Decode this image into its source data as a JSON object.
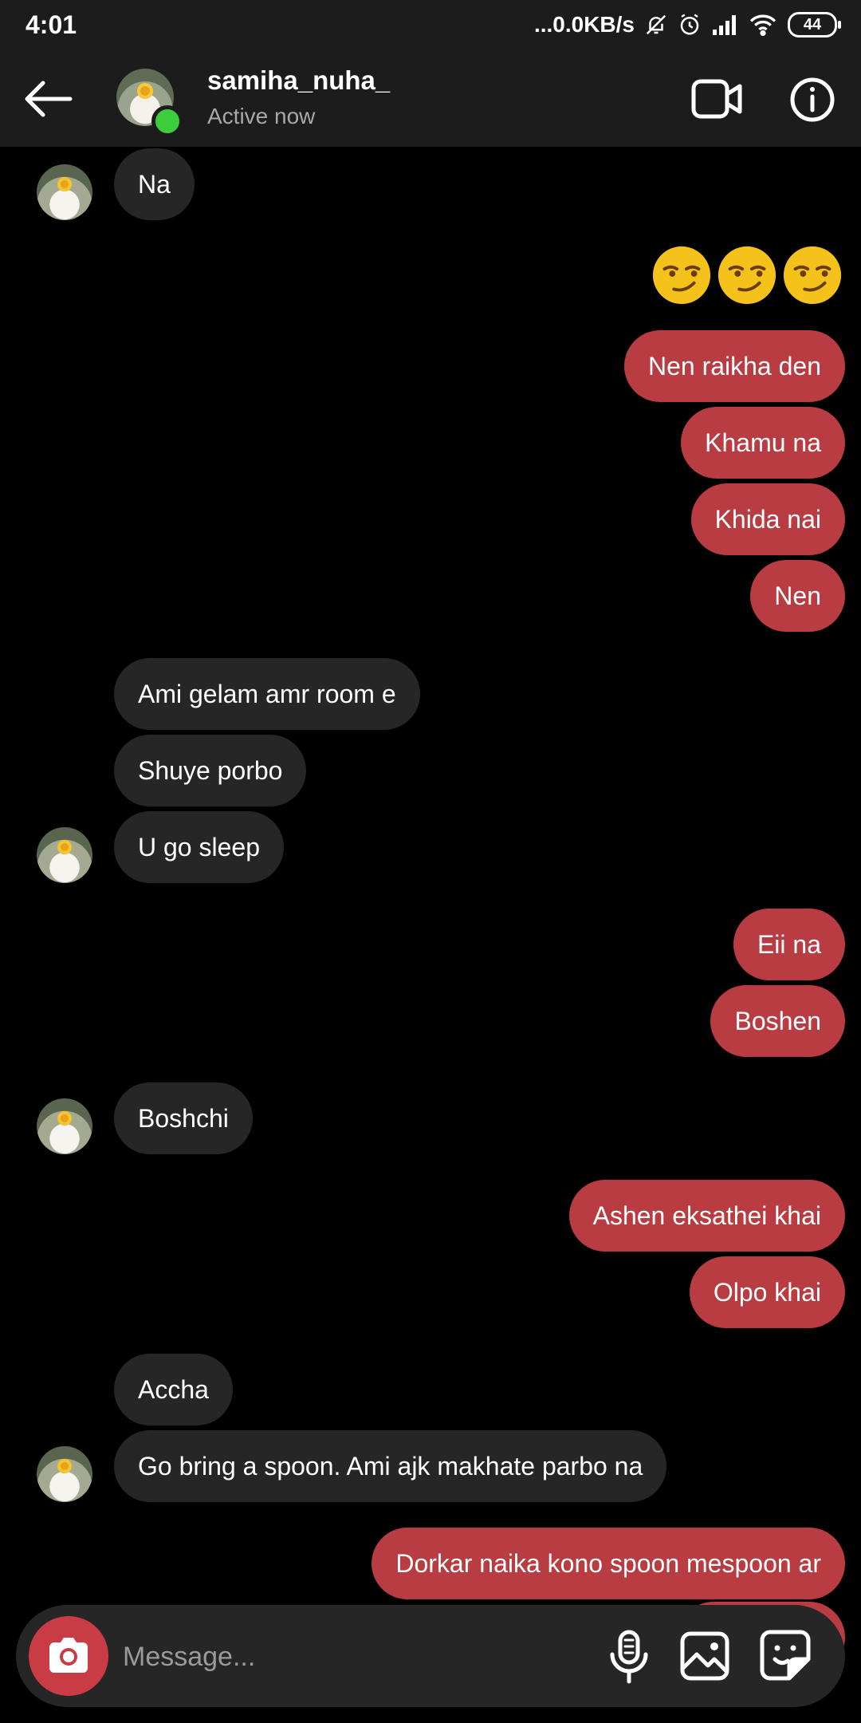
{
  "status_bar": {
    "time": "4:01",
    "network_speed": "...0.0KB/s",
    "battery": "44"
  },
  "header": {
    "username": "samiha_nuha_",
    "status": "Active now",
    "back_icon": "arrow-left-icon",
    "video_icon": "video-call-icon",
    "info_icon": "info-icon"
  },
  "messages": [
    {
      "dir": "in",
      "text": "Na"
    },
    {
      "dir": "out",
      "text": "😏😏😏"
    },
    {
      "dir": "out",
      "text": "Nen raikha den"
    },
    {
      "dir": "out",
      "text": "Khamu na"
    },
    {
      "dir": "out",
      "text": "Khida nai"
    },
    {
      "dir": "out",
      "text": "Nen"
    },
    {
      "dir": "in",
      "text": "Ami gelam amr room e"
    },
    {
      "dir": "in",
      "text": "Shuye porbo"
    },
    {
      "dir": "in",
      "text": "U go sleep"
    },
    {
      "dir": "out",
      "text": "Eii na"
    },
    {
      "dir": "out",
      "text": "Boshen"
    },
    {
      "dir": "in",
      "text": "Boshchi"
    },
    {
      "dir": "out",
      "text": "Ashen eksathei khai"
    },
    {
      "dir": "out",
      "text": "Olpo khai"
    },
    {
      "dir": "in",
      "text": "Accha"
    },
    {
      "dir": "in",
      "text": "Go bring a spoon. Ami ajk makhate parbo na"
    },
    {
      "dir": "out",
      "text": "Dorkar naika kono spoon mespoon ar"
    }
  ],
  "composer": {
    "placeholder": "Message...",
    "camera_icon": "camera-icon",
    "mic_icon": "microphone-icon",
    "gallery_icon": "gallery-icon",
    "sticker_icon": "sticker-icon"
  },
  "colors": {
    "outgoing_bubble": "#b83c42",
    "incoming_bubble": "#262626",
    "online": "#3ccd3c"
  }
}
